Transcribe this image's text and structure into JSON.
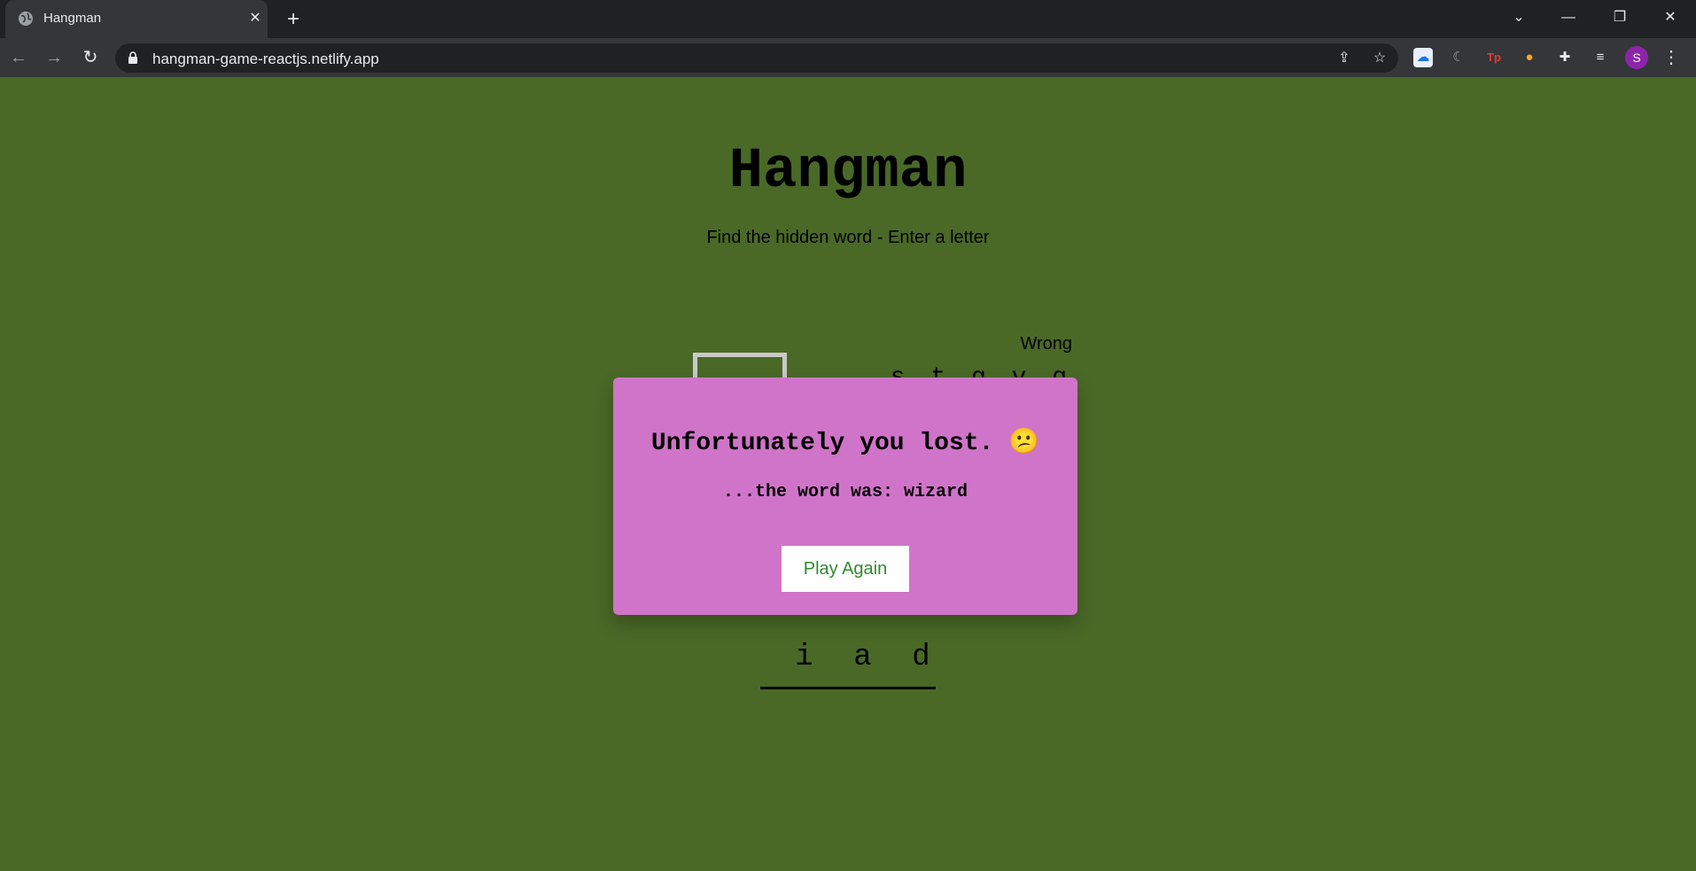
{
  "browser": {
    "tab_title": "Hangman",
    "url": "hangman-game-reactjs.netlify.app",
    "profile_initial": "S"
  },
  "page": {
    "title": "Hangman",
    "subtitle": "Find the hidden word - Enter a letter",
    "wrong_label": "Wrong",
    "wrong_letters": "s t g v q o",
    "word_slots": [
      "",
      "i",
      "",
      "a",
      "",
      "d"
    ]
  },
  "popup": {
    "title": "Unfortunately you lost. 😕",
    "subtitle": "...the word was: wizard",
    "button_label": "Play Again"
  },
  "colors": {
    "page_background": "#4a6927",
    "popup_background": "#d074c9",
    "button_text": "#2e8b2e"
  }
}
